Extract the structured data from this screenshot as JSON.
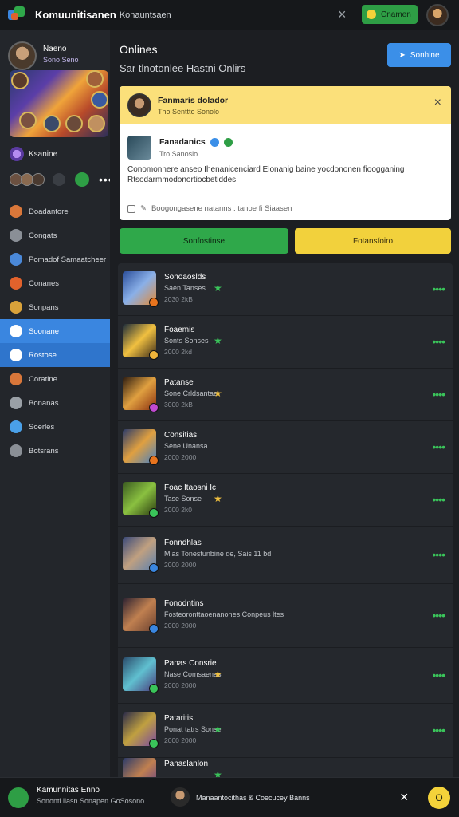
{
  "topbar": {
    "brand": "Komuunitisanen",
    "brand_sub": "Konauntsaen",
    "close_icon": "×",
    "button_label": "Cnamen",
    "avatar_icon": "user-avatar"
  },
  "sidebar": {
    "profile": {
      "name": "Naeno",
      "sub": "Sono Seno"
    },
    "games_label": "Ksanine",
    "friends_more": "•••",
    "items": [
      {
        "label": "Doadantore",
        "color": "#d9773a"
      },
      {
        "label": "Congats",
        "color": "#8a8f96"
      },
      {
        "label": "Pomadof Samaatcheer",
        "color": "#4a88d8"
      },
      {
        "label": "Conanes",
        "color": "#e2622c"
      },
      {
        "label": "Sonpans",
        "color": "#d9a23a"
      },
      {
        "label": "Soonane",
        "color": "#ffffff"
      },
      {
        "label": "Rostose",
        "color": "#ffffff"
      },
      {
        "label": "Coratine",
        "color": "#d9773a"
      },
      {
        "label": "Bonanas",
        "color": "#9aa0a6"
      },
      {
        "label": "Soerles",
        "color": "#4aa0e8"
      },
      {
        "label": "Botsrans",
        "color": "#8a8f96"
      }
    ]
  },
  "main": {
    "title": "Onlines",
    "subtitle": "Sar tlnotonlee Hastni Onlirs",
    "share_label": "Sonhine",
    "card": {
      "title": "Fanmaris dolador",
      "sub": "Tho Senttto Sonolo",
      "close": "×",
      "post_name": "Fanadanics",
      "post_time": "Tro Sanosio",
      "post_body": "Conomonnere anseo Ihenanicenciard Elonanig baine yocdononen fioogganing Rtsodarmmodonortiocbetiddes.",
      "post_footer": "Boogongasene natanns . tanoe fi Siaasen"
    },
    "btn_green": "Sonfostinse",
    "btn_yellow": "Fotansfoiro"
  },
  "list": [
    {
      "title": "Sonoaoslds",
      "sub": "Saen Tanses",
      "time": "2030 2kB",
      "star": "#3ac45a",
      "badge": "#e8741e",
      "thumb": [
        "#2b4e9a",
        "#8ab0e8",
        "#e08a3a"
      ],
      "h": 66
    },
    {
      "title": "Foaemis",
      "sub": "Sonts Sonses",
      "time": "2000 2kd",
      "star": "#3ac45a",
      "badge": "#f0b43a",
      "thumb": [
        "#1a2a3a",
        "#f0c040",
        "#3a2a1a"
      ],
      "h": 66
    },
    {
      "title": "Patanse",
      "sub": "Sone Crldsantae",
      "time": "3000 2kB",
      "star": "#f0c040",
      "badge": "#c04ad0",
      "thumb": [
        "#2a1a10",
        "#e0a040",
        "#8a3010"
      ],
      "h": 66
    },
    {
      "title": "Consitias",
      "sub": "Sene Unansa",
      "time": "2000 2000",
      "star": "",
      "badge": "#e8741e",
      "thumb": [
        "#2a3a6a",
        "#e0a040",
        "#4a80c0"
      ],
      "h": 66
    },
    {
      "title": "Foac Itaosni Ic",
      "sub": "Tase Sonse",
      "time": "2000 2k0",
      "star": "#f0c040",
      "badge": "#3ac45a",
      "thumb": [
        "#3a5a20",
        "#8ac040",
        "#2a3a10"
      ],
      "h": 66
    },
    {
      "title": "Fonndhlas",
      "sub": "Mlas Tonestunbine de, Sais 11 bd",
      "time": "2000 2000",
      "star": "",
      "badge": "#3a86e0",
      "thumb": [
        "#3a4a7a",
        "#c0a080",
        "#5a80b0"
      ],
      "h": 72
    },
    {
      "title": "Fonodntins",
      "sub": "Fosteoronttaoenanones Conpeus ltes",
      "time": "2000 2000",
      "star": "",
      "badge": "#3a86e0",
      "thumb": [
        "#2a2030",
        "#c08050",
        "#6a4030"
      ],
      "h": 80
    },
    {
      "title": "Panas Consrie",
      "sub": "Nase Comsaenas",
      "time": "2000 2000",
      "star": "#f0c040",
      "badge": "#3ac45a",
      "thumb": [
        "#2a4a6a",
        "#60c0d0",
        "#4a3a7a"
      ],
      "h": 70
    },
    {
      "title": "Pataritis",
      "sub": "Ponat tatrs Sonse",
      "time": "2000 2000",
      "star": "#3ac45a",
      "badge": "#3ac45a",
      "thumb": [
        "#2a2a4a",
        "#c0a040",
        "#7a4aa0"
      ],
      "h": 68
    },
    {
      "title": "Panaslanlon",
      "sub": "",
      "time": "",
      "star": "#3ac45a",
      "badge": "#3a86e0",
      "thumb": [
        "#2a3a6a",
        "#c08050",
        "#5a3a90"
      ],
      "h": 30
    }
  ],
  "bottombar": {
    "title": "Kamunnitas Enno",
    "sub": "Sononti liasn Sonapen GoSosono",
    "center": "Manaantocithas & Coecucey Banns",
    "x_icon": "×",
    "coin_label": "O"
  }
}
